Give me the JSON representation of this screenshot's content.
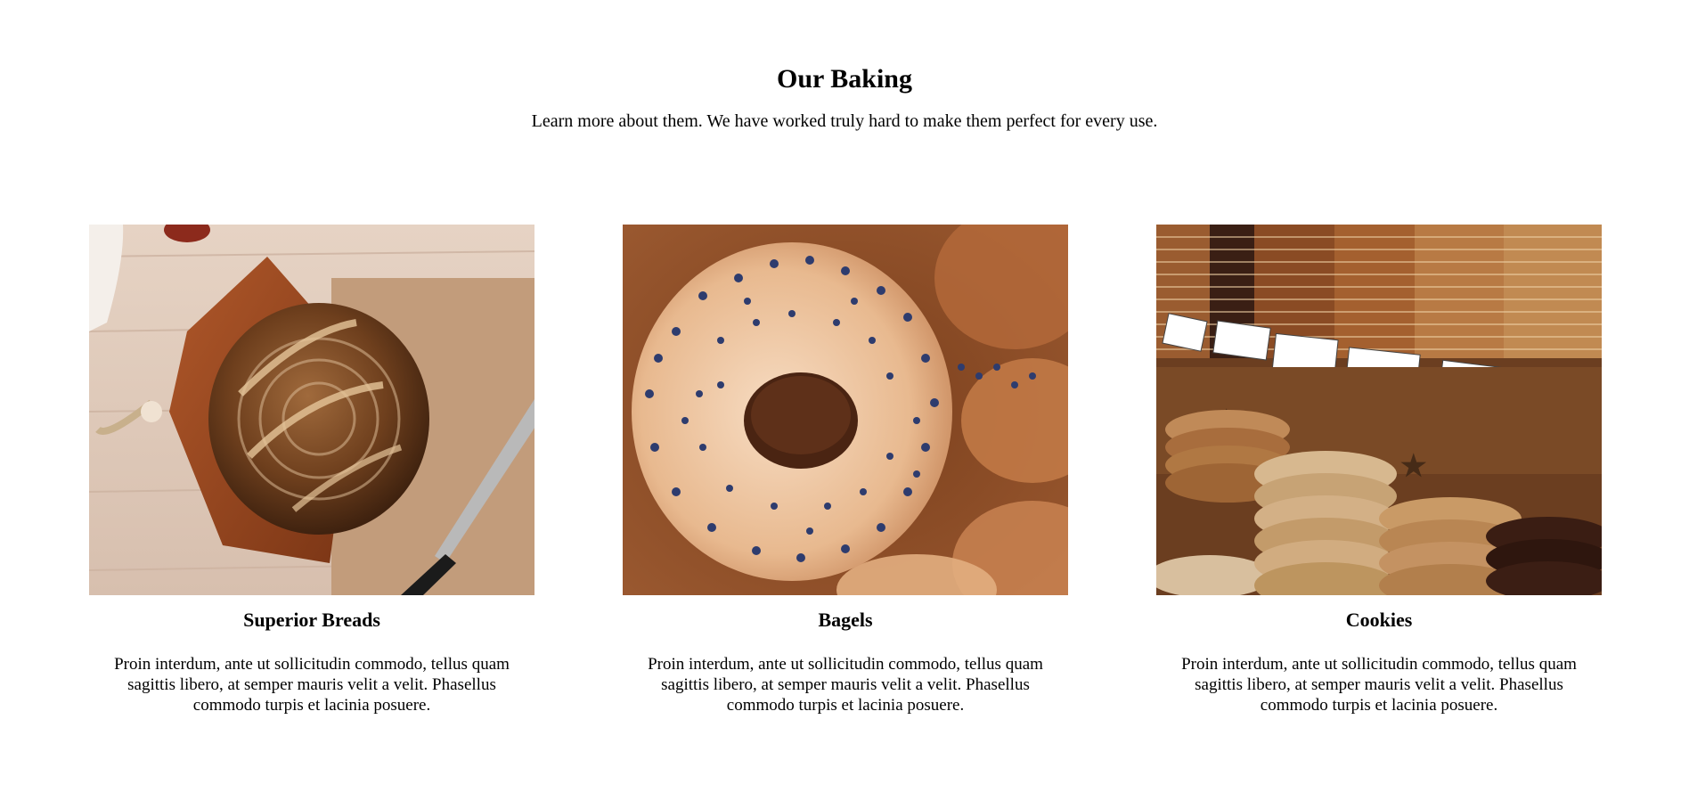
{
  "section": {
    "title": "Our Baking",
    "subtitle": "Learn more about them. We have worked truly hard to make them perfect for every use."
  },
  "cards": [
    {
      "image_icon": "bread-photo",
      "title": "Superior Breads",
      "text": "Proin interdum, ante ut sollicitudin commodo, tellus quam sagittis libero, at semper mauris velit a velit. Phasellus commodo turpis et lacinia posuere."
    },
    {
      "image_icon": "bagel-photo",
      "title": "Bagels",
      "text": "Proin interdum, ante ut sollicitudin commodo, tellus quam sagittis libero, at semper mauris velit a velit. Phasellus commodo turpis et lacinia posuere."
    },
    {
      "image_icon": "cookies-photo",
      "title": "Cookies",
      "text": "Proin interdum, ante ut sollicitudin commodo, tellus quam sagittis libero, at semper mauris velit a velit. Phasellus commodo turpis et lacinia posuere."
    }
  ]
}
